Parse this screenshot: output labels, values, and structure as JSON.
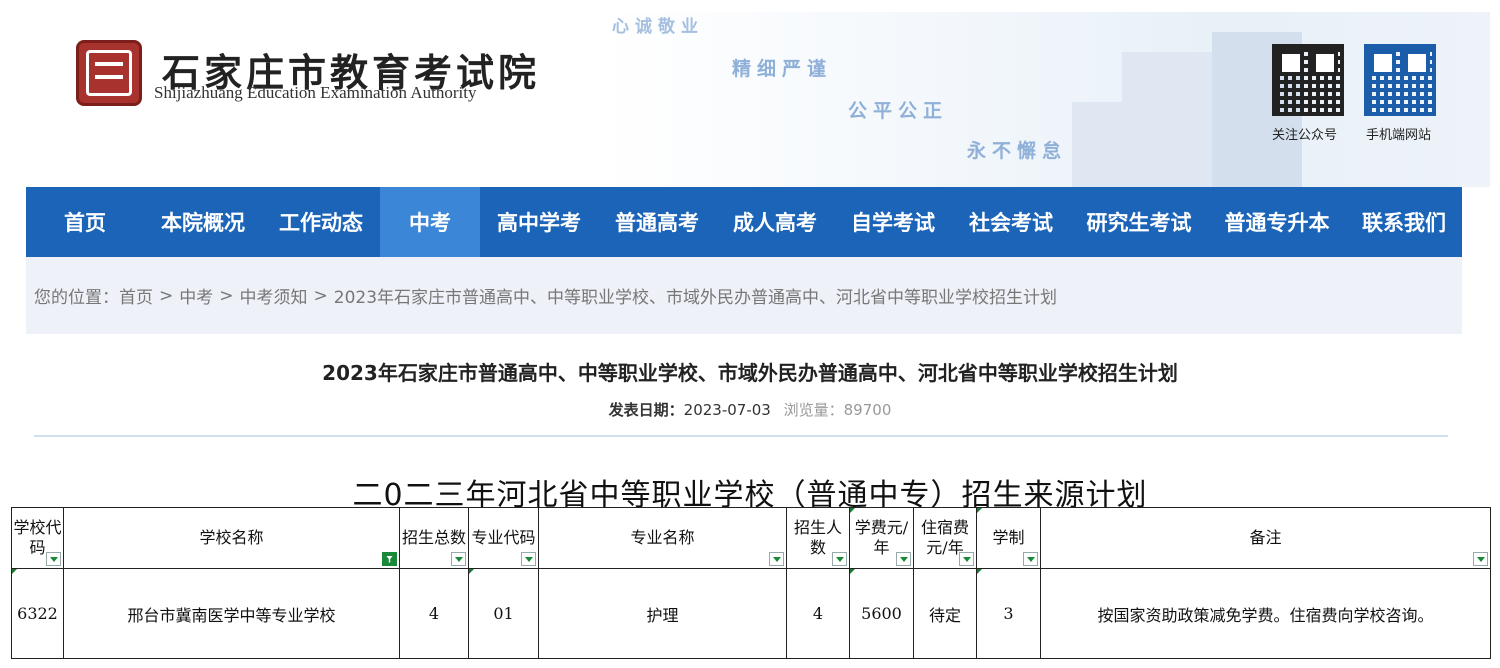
{
  "header": {
    "site_name": "石家庄市教育考试院",
    "site_name_en": "Shijiazhuang Education Examination Authority",
    "mottos": [
      "心诚敬业",
      "精细严谨",
      "公平公正",
      "永不懈怠"
    ],
    "qr_labels": [
      "关注公众号",
      "手机端网站"
    ],
    "logo_icon": "seal-logo-icon"
  },
  "nav": {
    "items": [
      "首页",
      "本院概况",
      "工作动态",
      "中考",
      "高中学考",
      "普通高考",
      "成人高考",
      "自学考试",
      "社会考试",
      "研究生考试",
      "普通专升本",
      "联系我们"
    ],
    "active": "中考",
    "color": "#1c64b8",
    "active_color": "#3b86d6"
  },
  "breadcrumb": {
    "prefix": "您的位置：",
    "items": [
      "首页",
      "中考",
      "中考须知",
      "2023年石家庄市普通高中、中等职业学校、市域外民办普通高中、河北省中等职业学校招生计划"
    ],
    "separator": ">"
  },
  "article": {
    "title": "2023年石家庄市普通高中、中等职业学校、市域外民办普通高中、河北省中等职业学校招生计划",
    "date_label": "发表日期：",
    "date": "2023-07-03",
    "views_label": "浏览量：",
    "views": "89700"
  },
  "sheet": {
    "title": "二0二三年河北省中等职业学校（普通中专）招生来源计划",
    "headers": [
      "学校代码",
      "学校名称",
      "招生总数",
      "专业代码",
      "专业名称",
      "招生人数",
      "学费元/年",
      "住宿费元/年",
      "学制",
      "备注"
    ],
    "rows": [
      [
        "6322",
        "邢台市冀南医学中等专业学校",
        "4",
        "01",
        "护理",
        "4",
        "5600",
        "待定",
        "3",
        "按国家资助政策减免学费。住宿费向学校咨询。"
      ]
    ]
  }
}
